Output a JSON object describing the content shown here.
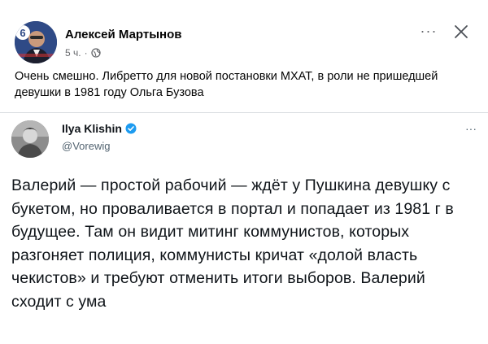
{
  "post": {
    "author": "Алексей Мартынов",
    "time": "5 ч.",
    "separator": "·",
    "text": "Очень смешно. Либретто для новой постановки МХАТ, в роли не пришедшей девушки в 1981 году Ольга Бузова",
    "more_label": "···",
    "icons": [
      "globe-icon",
      "more-icon",
      "close-icon"
    ]
  },
  "tweet": {
    "name": "Ilya Klishin",
    "handle": "@Vorewig",
    "more_label": "···",
    "text": "Валерий — простой рабочий — ждёт у Пушкина девушку с букетом, но проваливается в портал и попадает из 1981 г в будущее. Там он видит митинг коммунистов, которых разгоняет полиция, коммунисты кричат «долой власть чекистов» и требуют отменить итоги выборов. Валерий сходит с ума",
    "icons": [
      "verified-badge-icon"
    ]
  },
  "colors": {
    "primary_text": "#050505",
    "secondary_text": "#65676b",
    "verified_blue": "#1d9bf0",
    "tweet_text": "#0f1419",
    "handle_gray": "#536471",
    "avatar_blue": "#3a4a72"
  }
}
